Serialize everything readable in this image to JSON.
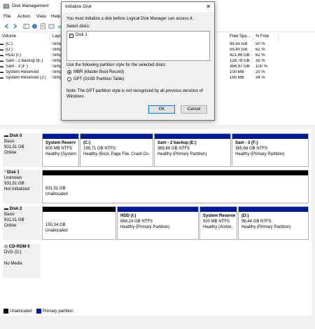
{
  "window": {
    "title": "Disk Management",
    "close_glyph": "✕",
    "minimize_glyph": "—",
    "maximize_glyph": "☐"
  },
  "menu": {
    "items": [
      "File",
      "Action",
      "View",
      "Help"
    ]
  },
  "volumes": {
    "columns": [
      "Volume",
      "Layout",
      "Free Spa...",
      "% Free"
    ],
    "rows": [
      {
        "volume": "(C:)",
        "layout": "Simp",
        "free": "99,55 GB",
        "pct": "50 %"
      },
      {
        "volume": "(D:)",
        "layout": "Simp",
        "free": "59,40 GB",
        "pct": "62 %"
      },
      {
        "volume": "HDD (I:)",
        "layout": "Simp",
        "free": "421,46 GB",
        "pct": "62 %"
      },
      {
        "volume": "Sam - 2 backup (E:)",
        "layout": "Simp",
        "free": "128,78 GB",
        "pct": "35 %"
      },
      {
        "volume": "Sam - 3 (F:)",
        "layout": "Simp",
        "free": "364,97 GB",
        "pct": "100 %"
      },
      {
        "volume": "System Reserved",
        "layout": "Simp",
        "free": "100 MB",
        "pct": "20 %"
      },
      {
        "volume": "System Reserved (J:)",
        "layout": "Simp",
        "free": "169 MB",
        "pct": "34 %"
      }
    ]
  },
  "dialog": {
    "title": "Initialize Disk",
    "intro": "You must initialize a disk before Logical Disk Manager can access it.",
    "select_label": "Select disks:",
    "disk_item": "Disk 1",
    "disk_checked": "✓",
    "style_label": "Use the following partition style for the selected disks:",
    "mbr_label": "MBR (Master Boot Record)",
    "gpt_label": "GPT (GUID Partition Table)",
    "note_line1": "Note: The GPT partition style is not recognized by all previous versions of",
    "note_line2": "Windows.",
    "ok": "OK",
    "cancel": "Cancel"
  },
  "disks": [
    {
      "name": "Disk 0",
      "type": "Basic",
      "size": "931,51 GB",
      "status": "Online",
      "partitions": [
        {
          "name": "System Reserv",
          "size": "500 MB NTFS",
          "status": "Healthy (System"
        },
        {
          "name": "(C:)",
          "size": "199,71 GB NTFS",
          "status": "Healthy (Boot, Page File, Crash Du"
        },
        {
          "name": "Sam - 2 backup  (E:)",
          "size": "365,66 GB NTFS",
          "status": "Healthy (Primary Partition)"
        },
        {
          "name": "Sam - 3  (F:)",
          "size": "365,66 GB NTFS",
          "status": "Healthy (Primary Partition)"
        }
      ]
    },
    {
      "name": "Disk 1",
      "type": "Unknown",
      "size": "931,51 GB",
      "status": "Not Initialized",
      "warn_glyph": "*",
      "partitions": [
        {
          "name": "",
          "size": "931,51 GB",
          "status": "Unallocated"
        }
      ]
    },
    {
      "name": "Disk 2",
      "type": "Basic",
      "size": "931,51 GB",
      "status": "Online",
      "partitions": [
        {
          "name": "",
          "size": "150,34 GB",
          "status": "Unallocated"
        },
        {
          "name": "HDD  (I:)",
          "size": "684,24 GB NTFS",
          "status": "Healthy (Primary Partition)"
        },
        {
          "name": "System Reserve",
          "size": "500 MB NTFS",
          "status": "Healthy (Active,"
        },
        {
          "name": "(D:)",
          "size": "96,44 GB NTFS",
          "status": "Healthy (Primary Partition)"
        }
      ]
    },
    {
      "name": "CD-ROM 0",
      "type": "DVD (G:)",
      "size": "",
      "status": "No Media"
    }
  ],
  "legend": {
    "unallocated": "Unallocated",
    "primary": "Primary partition"
  },
  "colors": {
    "primary": "#001b9a",
    "unallocated": "#000000"
  }
}
